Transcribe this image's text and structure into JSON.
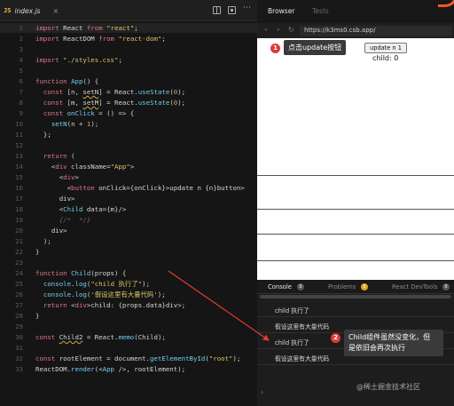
{
  "editor": {
    "js_badge": "JS",
    "filename": "index.js",
    "close": "×",
    "more": "⋯"
  },
  "code_lines": [
    {
      "n": "1",
      "html": "<span class=\"k\">import</span> React <span class=\"k\">from</span> <span class=\"s\">\"react\"</span>;"
    },
    {
      "n": "2",
      "html": "<span class=\"k\">import</span> ReactDOM <span class=\"k\">from</span> <span class=\"s\">\"react-dom\"</span>;"
    },
    {
      "n": "3",
      "html": ""
    },
    {
      "n": "4",
      "html": "<span class=\"k\">import</span> <span class=\"s\">\"./styles.css\"</span>;"
    },
    {
      "n": "5",
      "html": ""
    },
    {
      "n": "6",
      "html": "<span class=\"k\">function</span> <span class=\"f\">App</span>() {"
    },
    {
      "n": "7",
      "html": "  <span class=\"k\">const</span> [n, <span class=\"ul\">setN</span>] = React.<span class=\"f\">useState</span>(<span class=\"p\">0</span>);"
    },
    {
      "n": "8",
      "html": "  <span class=\"k\">const</span> [m, <span class=\"ul\">setM</span>] = React.<span class=\"f\">useState</span>(<span class=\"p\">0</span>);"
    },
    {
      "n": "9",
      "html": "  <span class=\"k\">const</span> <span class=\"f\">onClick</span> = () => {"
    },
    {
      "n": "10",
      "html": "    <span class=\"f\">setN</span>(n + <span class=\"p\">1</span>);"
    },
    {
      "n": "11",
      "html": "  };"
    },
    {
      "n": "12",
      "html": ""
    },
    {
      "n": "13",
      "html": "  <span class=\"k\">return</span> ("
    },
    {
      "n": "14",
      "html": "    <<span class=\"t\">div</span> className=<span class=\"s\">\"App\"</span>>"
    },
    {
      "n": "15",
      "html": "      <<span class=\"t\">div</span>>"
    },
    {
      "n": "16",
      "html": "        <<span class=\"t\">button</span> onClick={onClick}>update n {n}</<span class=\"t\">button</span>>"
    },
    {
      "n": "17",
      "html": "      </<span class=\"t\">div</span>>"
    },
    {
      "n": "18",
      "html": "      <<span class=\"f\">Child</span> data={m}/>"
    },
    {
      "n": "19",
      "html": "      <span class=\"c\">{/* <Child2 data={m}/> */}</span>"
    },
    {
      "n": "20",
      "html": "    </<span class=\"t\">div</span>>"
    },
    {
      "n": "21",
      "html": "  );"
    },
    {
      "n": "22",
      "html": "}"
    },
    {
      "n": "23",
      "html": ""
    },
    {
      "n": "24",
      "html": "<span class=\"k\">function</span> <span class=\"f\">Child</span>(props) {"
    },
    {
      "n": "25",
      "html": "  <span class=\"f\">console</span>.<span class=\"f\">log</span>(<span class=\"s\">\"child 执行了\"</span>);"
    },
    {
      "n": "26",
      "html": "  <span class=\"f\">console</span>.<span class=\"f\">log</span>(<span class=\"s\">'假设这里有大量代码'</span>);"
    },
    {
      "n": "27",
      "html": "  <span class=\"k\">return</span> <<span class=\"t\">div</span>>child: {props.data}</<span class=\"t\">div</span>>;"
    },
    {
      "n": "28",
      "html": "}"
    },
    {
      "n": "29",
      "html": ""
    },
    {
      "n": "30",
      "html": "<span class=\"k\">const</span> <span class=\"ul\">Child2</span> = React.<span class=\"f\">memo</span>(Child);"
    },
    {
      "n": "31",
      "html": ""
    },
    {
      "n": "32",
      "html": "<span class=\"k\">const</span> rootElement = document.<span class=\"f\">getElementById</span>(<span class=\"s\">\"root\"</span>);"
    },
    {
      "n": "33",
      "html": "ReactDOM.<span class=\"f\">render</span>(<<span class=\"f\">App</span> />, rootElement);"
    }
  ],
  "browser": {
    "tab_browser": "Browser",
    "tab_tests": "Tests",
    "back": "‹",
    "forward": "›",
    "reload": "↻",
    "url": "https://k3ms0.csb.app/",
    "button_label": "update n 1",
    "child_text": "child: 0"
  },
  "console": {
    "tab_console": "Console",
    "console_count": "0",
    "tab_problems": "Problems",
    "problems_count": "0",
    "tab_devtools": "React DevTools",
    "devtools_count": "0",
    "messages": [
      "child 执行了",
      "假设这里有大量代码",
      "child 执行了",
      "假设这里有大量代码"
    ],
    "prompt": "›"
  },
  "annotations": {
    "one_num": "1",
    "one_text": "点击update按钮",
    "two_num": "2",
    "two_text_line1": "Child组件虽然没变化，但",
    "two_text_line2": "是依旧会再次执行"
  },
  "watermark": "@稀土掘金技术社区",
  "colors": {
    "accent": "#e23a3a",
    "orange": "#f05a28",
    "editor_bg": "#151515"
  }
}
